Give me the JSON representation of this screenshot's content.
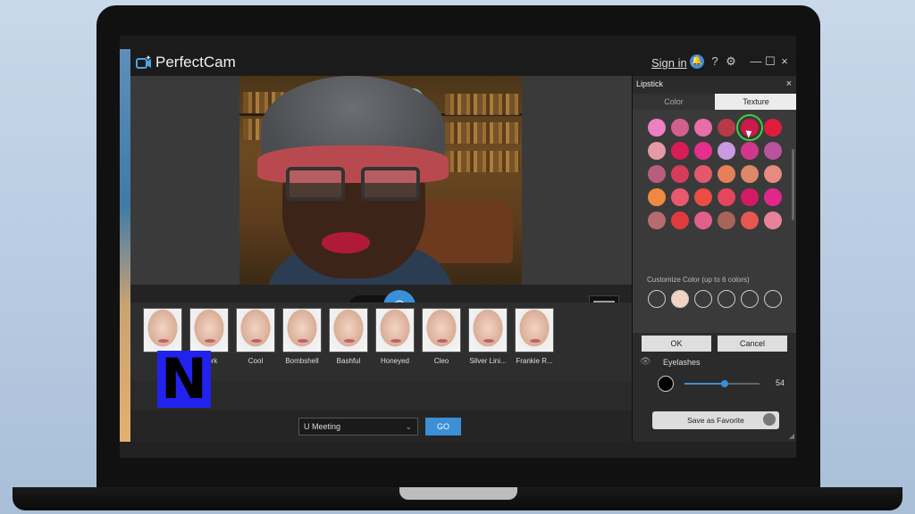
{
  "app": {
    "title": "PerfectCam",
    "signin": "Sign in",
    "help": "?",
    "minimize": "—",
    "maximize": "☐",
    "close": "×",
    "settings": "⚙"
  },
  "panel": {
    "title": "Lipstick",
    "close": "×",
    "tabs": {
      "color": "Color",
      "texture": "Texture"
    },
    "swatch_colors": [
      [
        "#ee7fc3",
        "#d35f8c",
        "#e86ea8",
        "#b83a47",
        "#cc1a4a",
        "#e01c3c"
      ],
      [
        "#e59aa6",
        "#d81c56",
        "#e62f8a",
        "#c89ae1",
        "#d0378a",
        "#b9539c"
      ],
      [
        "#b95d80",
        "#d33c5a",
        "#e2596c",
        "#e87f5b",
        "#dc8869",
        "#e58b7f"
      ],
      [
        "#ee8a40",
        "#e8596e",
        "#ea4e41",
        "#e4465f",
        "#d31b63",
        "#e2278a"
      ],
      [
        "#b86b6e",
        "#e03a3e",
        "#e0608c",
        "#a86459",
        "#e5574f",
        "#e6839a"
      ]
    ],
    "custom_label": "Customize Color (up to 6 colors)",
    "custom_first_color": "#f2d2c2",
    "ok": "OK",
    "cancel": "Cancel",
    "eyelashes": {
      "label": "Eyelashes",
      "value": "54",
      "level": 0.54
    },
    "favorite": "Save as Favorite"
  },
  "looks": [
    {
      "label": ""
    },
    {
      "label": "Work"
    },
    {
      "label": "Cool"
    },
    {
      "label": "Bombshell"
    },
    {
      "label": "Bashful"
    },
    {
      "label": "Honeyed"
    },
    {
      "label": "Cleo"
    },
    {
      "label": "Silver Lini..."
    },
    {
      "label": "Frankie R..."
    }
  ],
  "overlay_logo": "N",
  "meeting": {
    "selected": "U Meeting",
    "go": "GO"
  },
  "icons": {
    "video": "▶▮",
    "camera": "◉"
  },
  "colors": {
    "accent": "#3a8fd6",
    "selected_ring": "#3bd23b"
  }
}
